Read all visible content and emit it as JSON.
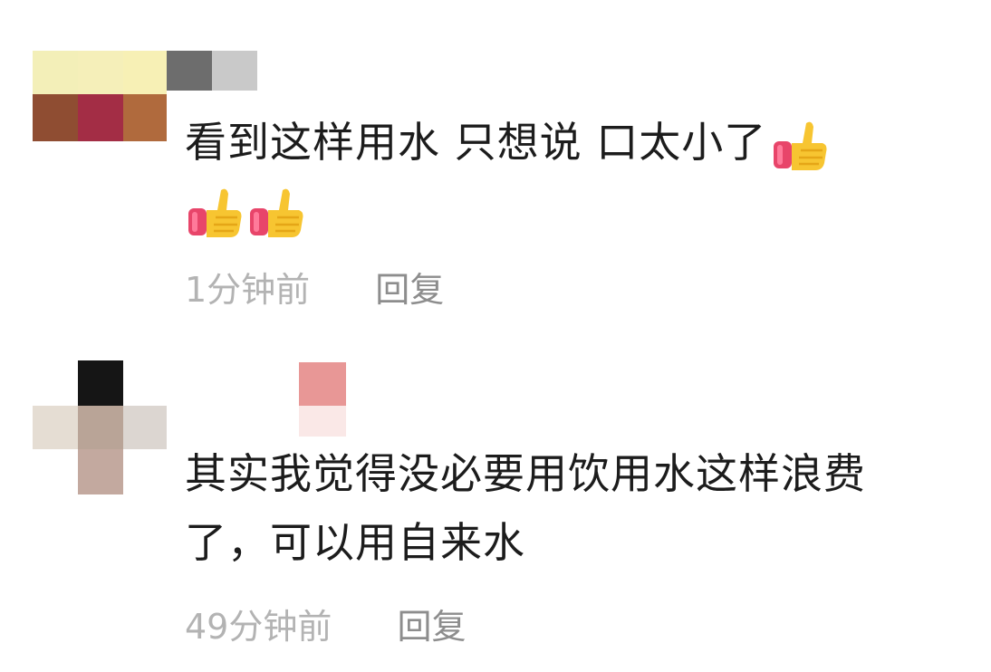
{
  "comments": [
    {
      "text_lines": [
        "看到这样用水  只想说 口太小了"
      ],
      "emoji_count": 3,
      "emoji_name": "thumbs-up",
      "time": "1分钟前",
      "reply_label": "回复"
    },
    {
      "text_lines": [
        "其实我觉得没必要用饮用水这样浪费",
        "了，可以用自来水"
      ],
      "time": "49分钟前",
      "reply_label": "回复"
    }
  ],
  "colors": {
    "text": "#1c1c1c",
    "meta": "#b3b3b3",
    "reply": "#8d8d8d",
    "thumb": "#f7c531",
    "cuff": "#e8456a"
  }
}
